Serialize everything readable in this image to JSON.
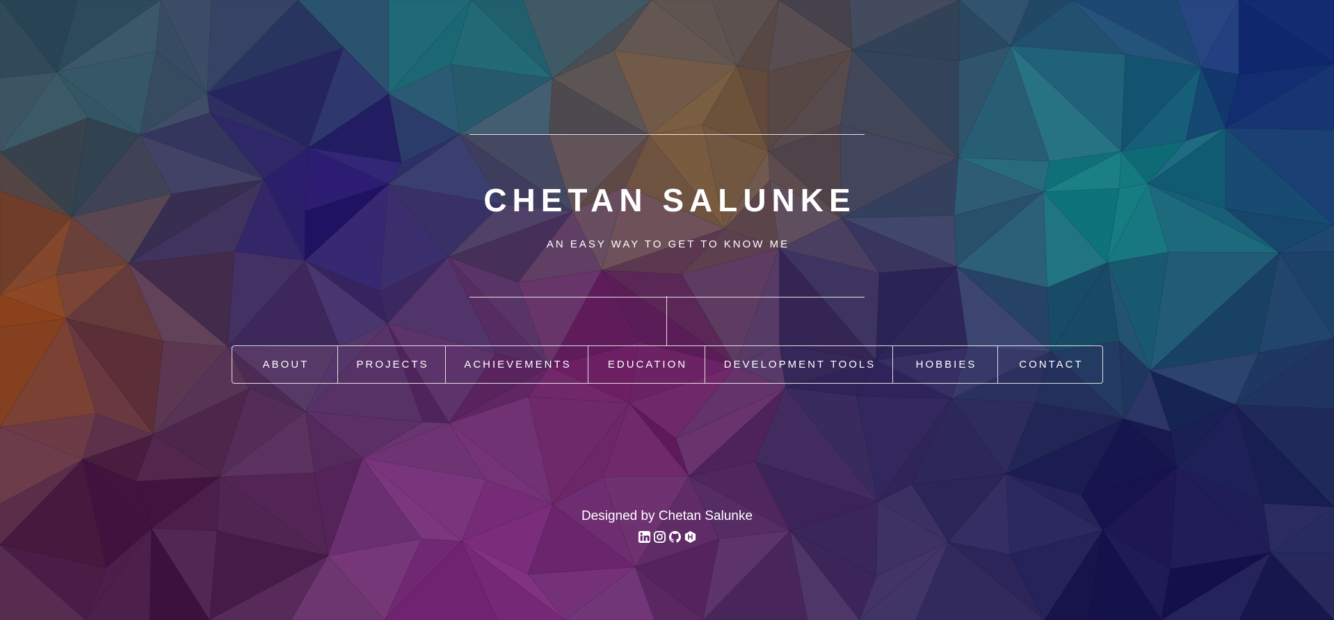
{
  "header": {
    "title": "CHETAN SALUNKE",
    "subtitle": "AN EASY WAY TO GET TO KNOW ME"
  },
  "nav": {
    "items": [
      {
        "label": "ABOUT"
      },
      {
        "label": "PROJECTS"
      },
      {
        "label": "ACHIEVEMENTS"
      },
      {
        "label": "EDUCATION"
      },
      {
        "label": "DEVELOPMENT TOOLS"
      },
      {
        "label": "HOBBIES"
      },
      {
        "label": "CONTACT"
      }
    ]
  },
  "footer": {
    "credit": "Designed by Chetan Salunke",
    "social_icons": [
      "linkedin-icon",
      "instagram-icon",
      "github-icon",
      "hackerrank-icon"
    ]
  },
  "colors": {
    "text": "#ffffff",
    "teal": "#137f85",
    "purple": "#7a1f78",
    "indigo": "#2a1570",
    "orange": "#a2502a"
  }
}
